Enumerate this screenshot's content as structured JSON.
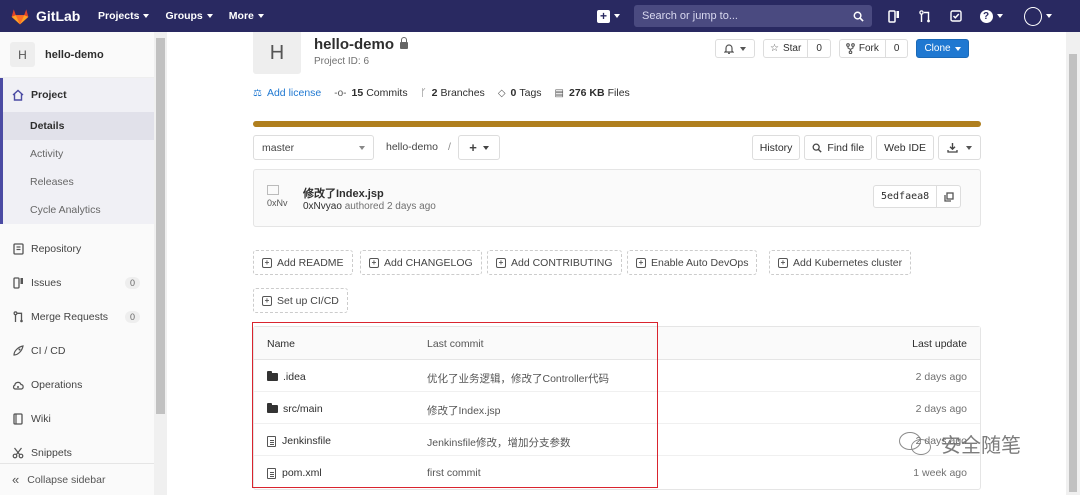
{
  "navbar": {
    "brand": "GitLab",
    "menu": [
      {
        "label": "Projects"
      },
      {
        "label": "Groups"
      },
      {
        "label": "More"
      }
    ],
    "plus_label": "+",
    "search_placeholder": "Search or jump to...",
    "bg_color": "#292961"
  },
  "sidebar": {
    "project_avatar": "H",
    "project_name": "hello-demo",
    "project_item": "Project",
    "sub_items": [
      {
        "label": "Details"
      },
      {
        "label": "Activity"
      },
      {
        "label": "Releases"
      },
      {
        "label": "Cycle Analytics"
      }
    ],
    "items": [
      {
        "label": "Repository",
        "icon": "book-icon"
      },
      {
        "label": "Issues",
        "icon": "issues-icon",
        "badge": "0"
      },
      {
        "label": "Merge Requests",
        "icon": "merge-request-icon",
        "badge": "0"
      },
      {
        "label": "CI / CD",
        "icon": "rocket-icon"
      },
      {
        "label": "Operations",
        "icon": "cloud-gear-icon"
      },
      {
        "label": "Wiki",
        "icon": "wiki-icon"
      },
      {
        "label": "Snippets",
        "icon": "scissors-icon"
      }
    ],
    "collapse_label": "Collapse sidebar"
  },
  "project": {
    "avatar_letter": "H",
    "name": "hello-demo",
    "id_label": "Project ID: 6",
    "star_label": "Star",
    "star_count": "0",
    "fork_label": "Fork",
    "fork_count": "0",
    "clone_label": "Clone"
  },
  "stats": {
    "add_license": "Add license",
    "commits_count": "15",
    "commits_label": "Commits",
    "branches_count": "2",
    "branches_label": "Branches",
    "tags_count": "0",
    "tags_label": "Tags",
    "files_size": "276 KB",
    "files_label": "Files",
    "language_color": "#b07f1e",
    "language_share": 1.0
  },
  "branch_bar": {
    "branch": "master",
    "crumb": "hello-demo",
    "separator": "/",
    "history": "History",
    "find_file": "Find file",
    "web_ide": "Web IDE"
  },
  "last_commit": {
    "avatar_alt": "0xNv",
    "title": "修改了Index.jsp",
    "author": "0xNvyao",
    "meta": "authored 2 days ago",
    "sha": "5edfaea8"
  },
  "quick_actions": [
    {
      "label": "Add README"
    },
    {
      "label": "Add CHANGELOG"
    },
    {
      "label": "Add CONTRIBUTING"
    },
    {
      "label": "Enable Auto DevOps"
    },
    {
      "label": "Add Kubernetes cluster"
    },
    {
      "label": "Set up CI/CD"
    }
  ],
  "file_tree": {
    "headers": {
      "name": "Name",
      "last_commit": "Last commit",
      "last_update": "Last update"
    },
    "rows": [
      {
        "name": ".idea",
        "type": "folder",
        "commit": "优化了业务逻辑，修改了Controller代码",
        "updated": "2 days ago"
      },
      {
        "name": "src/main",
        "type": "folder",
        "commit": "修改了Index.jsp",
        "updated": "2 days ago"
      },
      {
        "name": "Jenkinsfile",
        "type": "file",
        "commit": "Jenkinsfile修改，增加分支参数",
        "updated": "2 days ago"
      },
      {
        "name": "pom.xml",
        "type": "file",
        "commit": "first commit",
        "updated": "1 week ago"
      }
    ]
  },
  "watermark": "安全随笔",
  "highlight_color": "#d9242e"
}
